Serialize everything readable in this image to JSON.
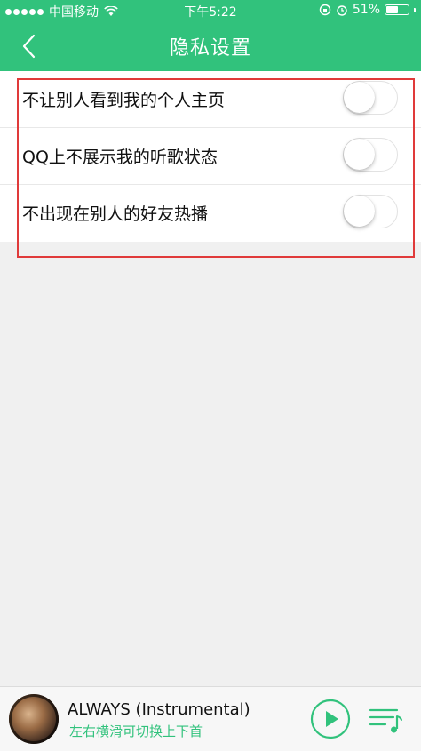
{
  "status_bar": {
    "carrier": "中国移动",
    "time": "下午5:22",
    "battery": "51%",
    "battery_level": 0.51
  },
  "nav": {
    "title": "隐私设置"
  },
  "settings": [
    {
      "label": "不让别人看到我的个人主页",
      "enabled": false
    },
    {
      "label": "QQ上不展示我的听歌状态",
      "enabled": false
    },
    {
      "label": "不出现在别人的好友热播",
      "enabled": false
    }
  ],
  "player": {
    "song_title": "ALWAYS (Instrumental)",
    "hint": "左右横滑可切换上下首"
  },
  "colors": {
    "accent": "#31c27c",
    "highlight": "#e03a3a"
  }
}
